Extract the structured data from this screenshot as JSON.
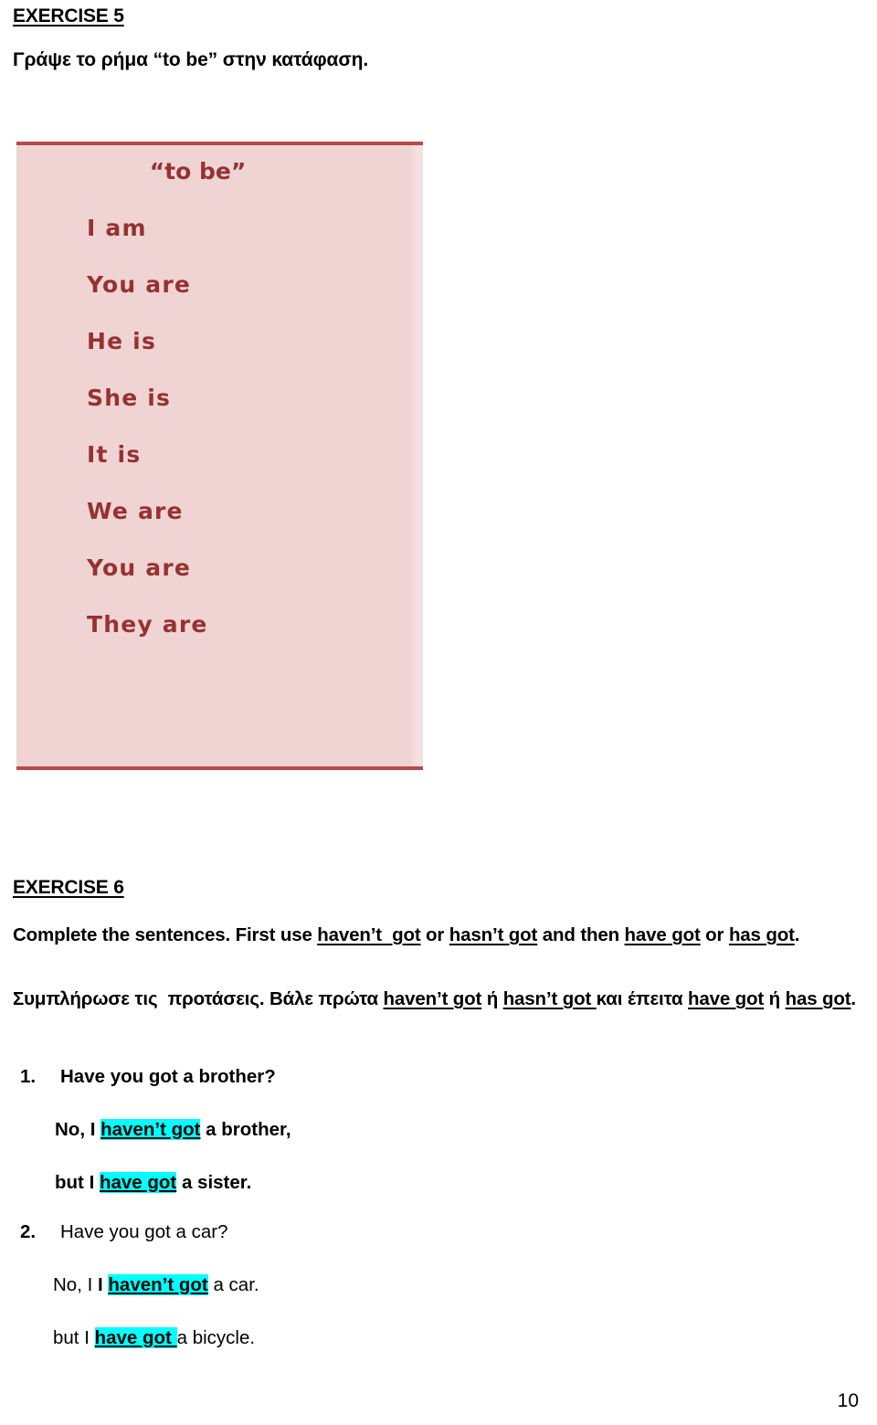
{
  "exercise5": {
    "heading": "EXERCISE 5",
    "prompt": "Γράψε το ρήμα “to be” στην κατάφαση.",
    "table": {
      "title": "“to be”",
      "background_color": "#f0d4d4",
      "border_color": "#b44a4a",
      "text_color": "#963232",
      "rows": [
        "I am",
        "You are",
        "He is",
        "She is",
        "It is",
        "We are",
        "You are",
        "They are"
      ]
    }
  },
  "exercise6": {
    "heading": "EXERCISE 6",
    "instruction_en": {
      "part1": "Complete the sentences. First use ",
      "u1": "haven’t  got",
      "part2": " or ",
      "u2": "hasn’t got",
      "part3": " and then ",
      "u3": "have got",
      "part4": " or ",
      "u4": "has got",
      "part5": "."
    },
    "instruction_el": {
      "part1": "Συμπλήρωσε τις  προτάσεις. Βάλε πρώτα ",
      "u1": "haven’t got",
      "part2": " ή ",
      "u2": "hasn’t got ",
      "part3": "και έπειτα ",
      "u3": "have got",
      "part4": " ή ",
      "u4": "has got",
      "part5": "."
    },
    "highlight_color": "#00ffff",
    "items": [
      {
        "number": "1.",
        "question": "Have you got a brother?",
        "answer1_pre": "No, I ",
        "answer1_hl": "haven’t got",
        "answer1_post": " a brother,",
        "answer2_pre": "but I ",
        "answer2_hl": "have got",
        "answer2_post": " a sister.",
        "bold": true
      },
      {
        "number": "2.",
        "question": "Have you got a car?",
        "answer1_pre": "No, I ",
        "answer1_bold_pre": "I ",
        "answer1_hl": "haven’t got",
        "answer1_post": " a car.",
        "answer2_pre": "but I ",
        "answer2_hl": "have got ",
        "answer2_post": "a bicycle.",
        "bold": false
      }
    ]
  },
  "footer": {
    "page_number": "10"
  }
}
